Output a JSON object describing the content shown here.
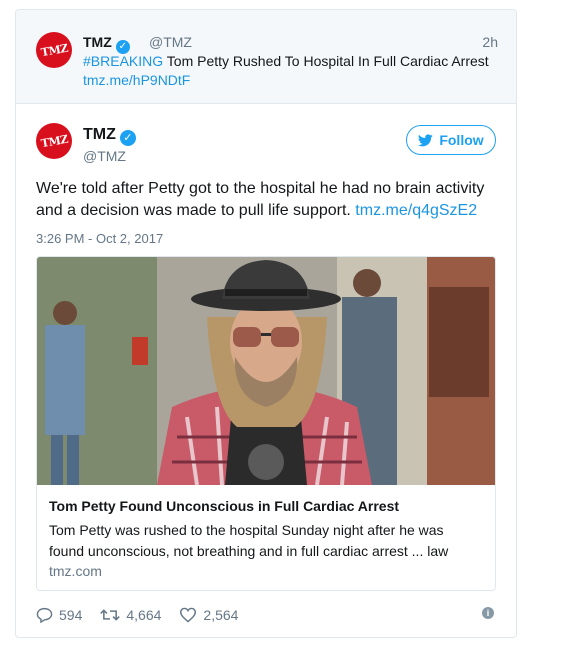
{
  "parent_tweet": {
    "name": "TMZ",
    "handle": "@TMZ",
    "time": "2h",
    "hashtag": "#BREAKING",
    "text": " Tom Petty Rushed To Hospital In Full Cardiac Arrest",
    "link": "tmz.me/hP9NDtF",
    "avatar_text": "TMZ"
  },
  "tweet": {
    "name": "TMZ",
    "handle": "@TMZ",
    "avatar_text": "TMZ",
    "follow_label": "Follow",
    "text": "We're told after Petty got to the hospital he had no brain activity and a decision was made to pull life support. ",
    "link": "tmz.me/q4gSzE2",
    "timestamp": "3:26 PM - Oct 2, 2017"
  },
  "card": {
    "title": "Tom Petty Found Unconscious in Full Cardiac Arrest",
    "description": "Tom Petty was rushed to the hospital Sunday night after he was found unconscious, not breathing and in full cardiac arrest ... law",
    "domain": "tmz.com",
    "image_icon": "photo-of-man-in-hat-and-sunglasses"
  },
  "actions": {
    "replies": "594",
    "retweets": "4,664",
    "likes": "2,564"
  },
  "colors": {
    "accent": "#1da1f2",
    "link": "#1b95e0",
    "brand_red": "#d8101e",
    "muted": "#657786"
  }
}
